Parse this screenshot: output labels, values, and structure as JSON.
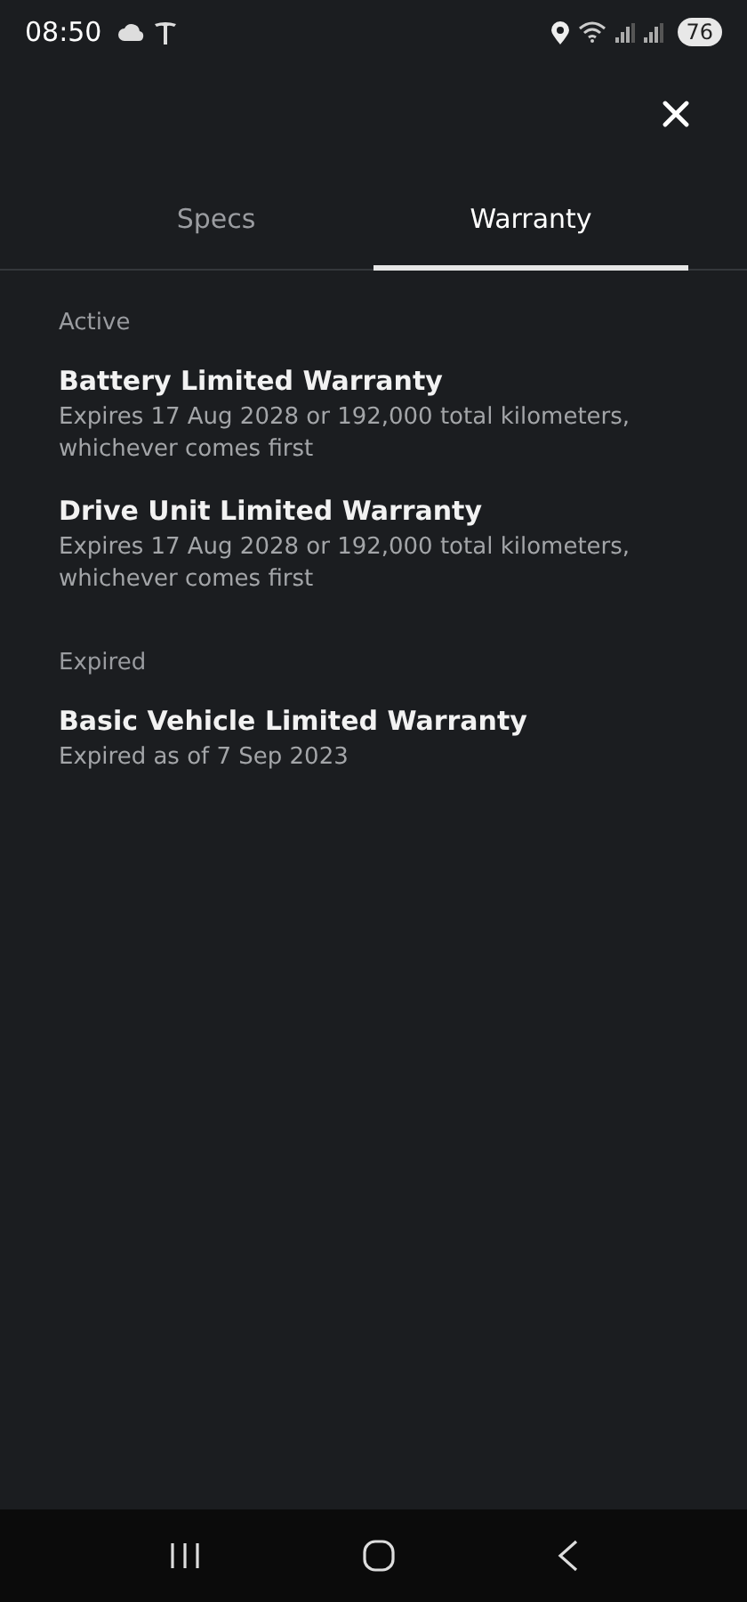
{
  "status_bar": {
    "time": "08:50",
    "battery": "76"
  },
  "tabs": [
    {
      "label": "Specs",
      "selected": false
    },
    {
      "label": "Warranty",
      "selected": true
    }
  ],
  "sections": [
    {
      "title": "Active",
      "items": [
        {
          "title": "Battery Limited Warranty",
          "subtitle": "Expires 17 Aug 2028 or 192,000 total kilometers, whichever comes first"
        },
        {
          "title": "Drive Unit Limited Warranty",
          "subtitle": "Expires 17 Aug 2028 or 192,000 total kilometers, whichever comes first"
        }
      ]
    },
    {
      "title": "Expired",
      "items": [
        {
          "title": "Basic Vehicle Limited Warranty",
          "subtitle": "Expired as of 7 Sep 2023"
        }
      ]
    }
  ]
}
